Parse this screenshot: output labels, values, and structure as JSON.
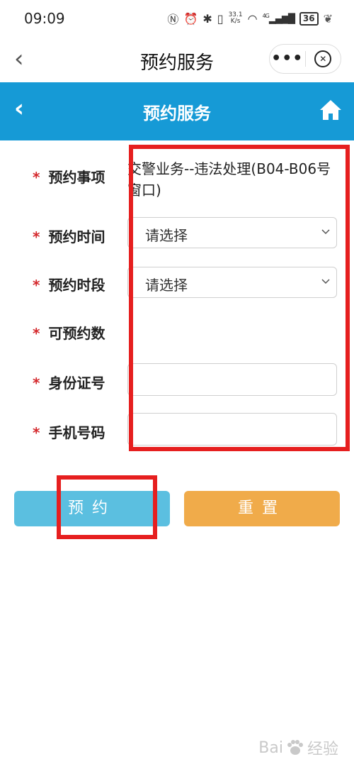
{
  "status_bar": {
    "time": "09:09",
    "net_speed_top": "33.1",
    "net_speed_bottom": "K/s",
    "signal": "4G",
    "battery": "36"
  },
  "wechat_nav": {
    "title": "预约服务",
    "more": "•••"
  },
  "header": {
    "title": "预约服务"
  },
  "form": {
    "item_label": "预约事项",
    "item_value": "交警业务--违法处理(B04-B06号窗口)",
    "date_label": "预约时间",
    "date_value": "请选择",
    "slot_label": "预约时段",
    "slot_value": "请选择",
    "count_label": "可预约数",
    "count_value": "",
    "id_label": "身份证号",
    "id_value": "",
    "phone_label": "手机号码",
    "phone_value": "",
    "required_mark": "*"
  },
  "buttons": {
    "book": "预约",
    "reset": "重置"
  },
  "watermark": {
    "text": "Bai",
    "text2": "经验"
  },
  "colors": {
    "header_bg": "#169ad6",
    "book_bg": "#5bbfe0",
    "reset_bg": "#f0ab4a",
    "required": "#d4282c",
    "annotation": "#e61f1f"
  }
}
